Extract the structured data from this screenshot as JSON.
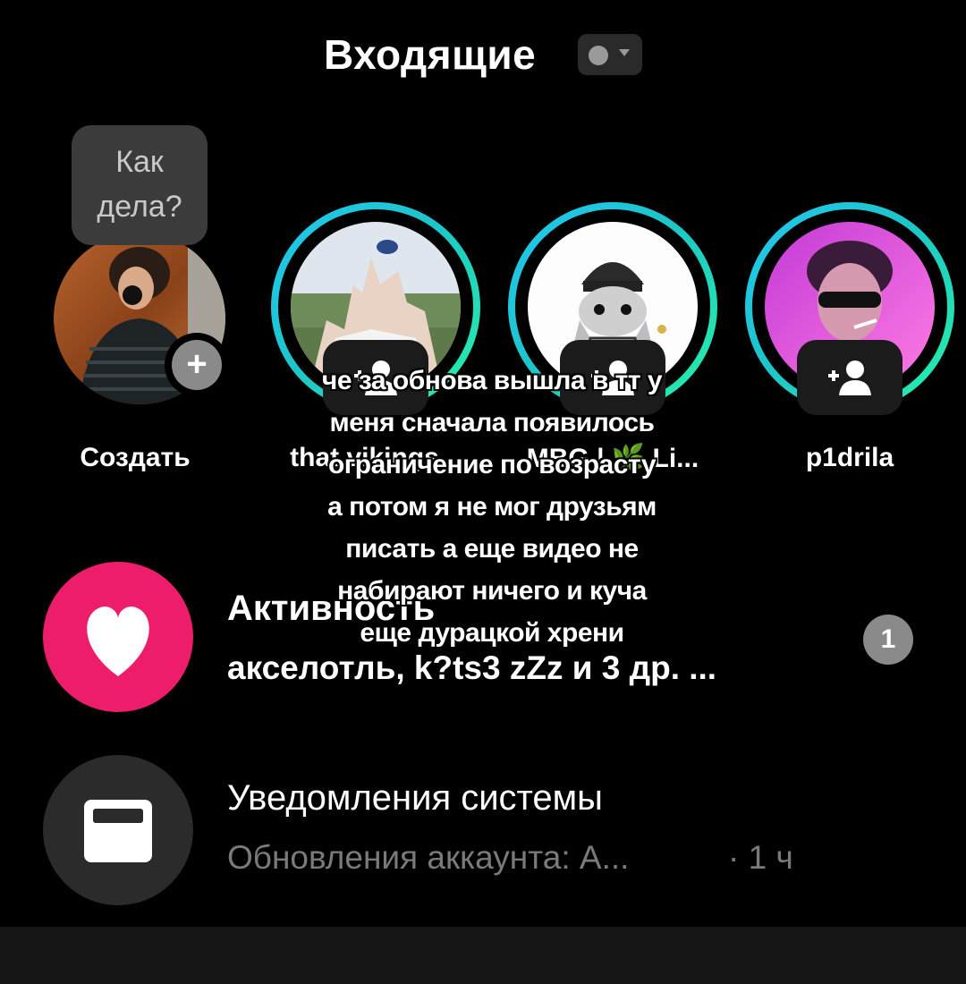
{
  "header": {
    "title": "Входящие"
  },
  "stories": [
    {
      "name": "Создать",
      "bubble": [
        "Как",
        "дела?"
      ],
      "add_symbol": "+"
    },
    {
      "name": "that vikings..."
    },
    {
      "name": "MBG | 🌿 Li..."
    },
    {
      "name": "p1drila"
    }
  ],
  "caption": {
    "lines": [
      "че за обнова вышла в тт у",
      "меня сначала появилось",
      "ограничение по возрасту",
      "а потом я не мог друзьям",
      "писать а еще видео не",
      "набирают ничего и куча",
      "еще дурацкой хрени"
    ]
  },
  "activity": {
    "title": "Активность",
    "subtitle": "акселотль, k?ts3 zZz и 3 др. ...",
    "badge": "1",
    "icon": "heart-icon",
    "color": "#ee1d6b"
  },
  "system": {
    "title": "Уведомления системы",
    "subtitle": "Обновления аккаунта: А...",
    "time": "· 1 ч",
    "icon": "inbox-icon",
    "color": "#2b2b2b"
  }
}
